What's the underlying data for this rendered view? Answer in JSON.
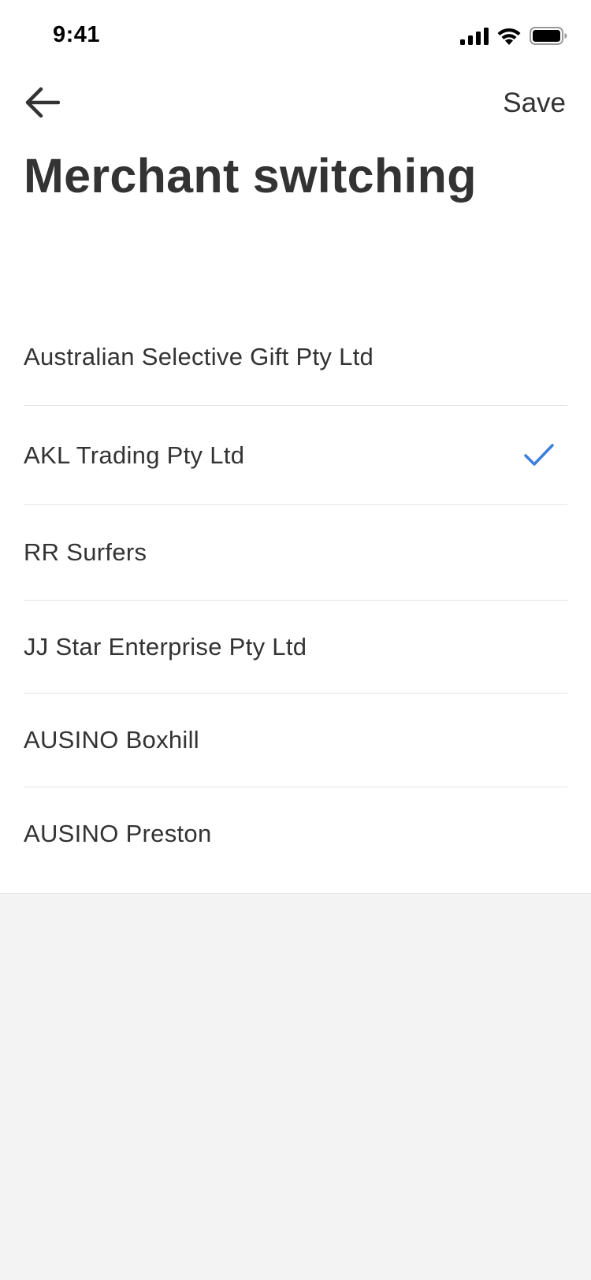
{
  "status_bar": {
    "time": "9:41",
    "icons": [
      "signal-icon",
      "wifi-icon",
      "battery-icon"
    ]
  },
  "nav": {
    "back_icon": "arrow-left-icon",
    "save_label": "Save"
  },
  "page": {
    "title": "Merchant switching"
  },
  "merchants": [
    {
      "name": "Australian Selective Gift Pty Ltd",
      "selected": false
    },
    {
      "name": "AKL Trading Pty Ltd",
      "selected": true
    },
    {
      "name": "RR Surfers",
      "selected": false
    },
    {
      "name": "JJ Star Enterprise Pty Ltd",
      "selected": false
    },
    {
      "name": "AUSINO Boxhill",
      "selected": false
    },
    {
      "name": "AUSINO Preston",
      "selected": false
    }
  ],
  "colors": {
    "accent": "#3b7de0",
    "text": "#333333",
    "divider": "#e4e4e4",
    "background_lower": "#f3f3f3"
  }
}
